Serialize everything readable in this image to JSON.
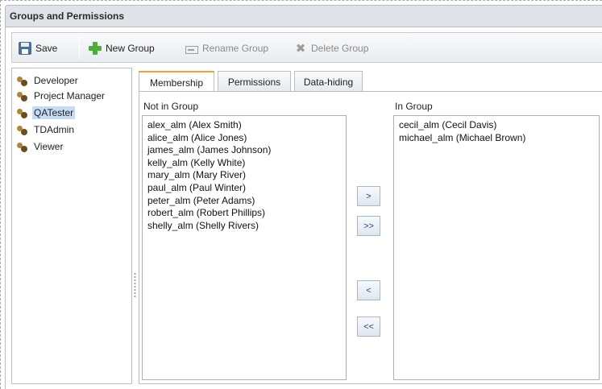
{
  "window": {
    "title": "Groups and Permissions"
  },
  "toolbar": {
    "save_label": "Save",
    "new_group_label": "New Group",
    "rename_group_label": "Rename Group",
    "delete_group_label": "Delete Group"
  },
  "groups": {
    "items": [
      {
        "label": "Developer"
      },
      {
        "label": "Project Manager"
      },
      {
        "label": "QATester",
        "selected": true
      },
      {
        "label": "TDAdmin"
      },
      {
        "label": "Viewer"
      }
    ]
  },
  "tabs": [
    {
      "label": "Membership",
      "active": true
    },
    {
      "label": "Permissions"
    },
    {
      "label": "Data-hiding"
    }
  ],
  "membership": {
    "not_in_group_label": "Not in Group",
    "in_group_label": "In Group",
    "not_in_group": [
      "alex_alm (Alex Smith)",
      "alice_alm (Alice Jones)",
      "james_alm (James Johnson)",
      "kelly_alm (Kelly White)",
      "mary_alm (Mary River)",
      "paul_alm (Paul Winter)",
      "peter_alm (Peter Adams)",
      "robert_alm (Robert Phillips)",
      "shelly_alm (Shelly Rivers)"
    ],
    "in_group": [
      "cecil_alm (Cecil Davis)",
      "michael_alm (Michael Brown)"
    ],
    "buttons": {
      "add": ">",
      "add_all": ">>",
      "remove": "<",
      "remove_all": "<<"
    }
  },
  "icons": {
    "save": "save-icon",
    "new_group": "plus-icon",
    "rename_group": "rename-icon",
    "delete_group": "delete-icon",
    "group": "group-icon"
  },
  "colors": {
    "selection": "#c6dcf5",
    "active_tab_accent": "#f0a030",
    "plus_icon": "#4caf3c"
  }
}
